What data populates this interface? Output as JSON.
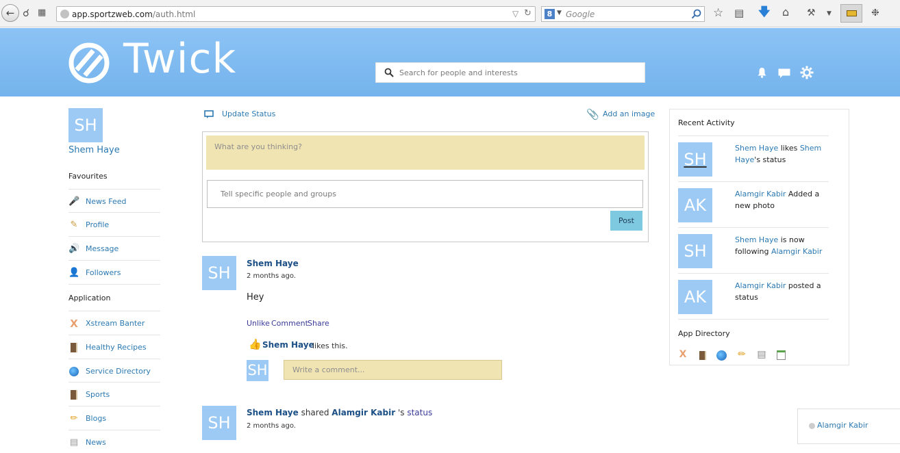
{
  "browser": {
    "url_domain": "app.sportzweb.com",
    "url_path": "/auth.html",
    "search_placeholder": "Google"
  },
  "header": {
    "logo_text": "Twick",
    "search_placeholder": "Search for people and interests"
  },
  "profile": {
    "initials": "SH",
    "name": "Shem Haye"
  },
  "favourites": {
    "heading": "Favourites",
    "items": [
      {
        "label": "News Feed",
        "icon": "microphone-icon"
      },
      {
        "label": "Profile",
        "icon": "profile-card-icon"
      },
      {
        "label": "Message",
        "icon": "megaphone-icon"
      },
      {
        "label": "Followers",
        "icon": "person-icon"
      }
    ]
  },
  "application": {
    "heading": "Application",
    "items": [
      {
        "label": "Xstream Banter",
        "icon": "x-icon"
      },
      {
        "label": "Healthy Recipes",
        "icon": "book-icon"
      },
      {
        "label": "Service Directory",
        "icon": "globe-icon"
      },
      {
        "label": "Sports",
        "icon": "book-icon"
      },
      {
        "label": "Blogs",
        "icon": "pencil-icon"
      },
      {
        "label": "News",
        "icon": "newspaper-icon"
      }
    ]
  },
  "composer": {
    "update_status": "Update Status",
    "add_image": "Add an image",
    "thinking_placeholder": "What are you thinking?",
    "tell_placeholder": "Tell specific people and groups",
    "post_label": "Post"
  },
  "feed": {
    "post1": {
      "initials": "SH",
      "author": "Shem Haye",
      "time": "2 months ago.",
      "body": "Hey",
      "actions": [
        "Unlike",
        "Comment",
        "Share"
      ],
      "likes_name": "Shem Haye",
      "likes_text": "likes this.",
      "comment_initials": "SH",
      "comment_placeholder": "Write a comment..."
    },
    "post2": {
      "initials": "SH",
      "author": "Shem Haye",
      "shared": "shared",
      "target": "Alamgir Kabir",
      "suffix": "'s",
      "object": "status",
      "time": "2 months ago."
    }
  },
  "recent": {
    "heading": "Recent Activity",
    "items": [
      {
        "initials": "SH",
        "a": "Shem Haye",
        "b": " likes ",
        "c": "Shem Haye",
        "d": "'s status"
      },
      {
        "initials": "AK",
        "a": "Alamgir Kabir",
        "b": " Added a new photo",
        "c": "",
        "d": ""
      },
      {
        "initials": "SH",
        "a": "Shem Haye",
        "b": " is now following ",
        "c": "Alamgir Kabir",
        "d": ""
      },
      {
        "initials": "AK",
        "a": "Alamgir Kabir",
        "b": " posted a status",
        "c": "",
        "d": ""
      }
    ],
    "app_directory": "App Directory"
  },
  "chat": {
    "contact": "Alamgir Kabir"
  },
  "colors": {
    "header_top": "#8cc3f5",
    "header_bottom": "#74b3ec",
    "avatar": "#9ccaf4",
    "link": "#2b79b2",
    "composer_fill": "#f1e4b3",
    "post_button": "#7fc9e0"
  }
}
